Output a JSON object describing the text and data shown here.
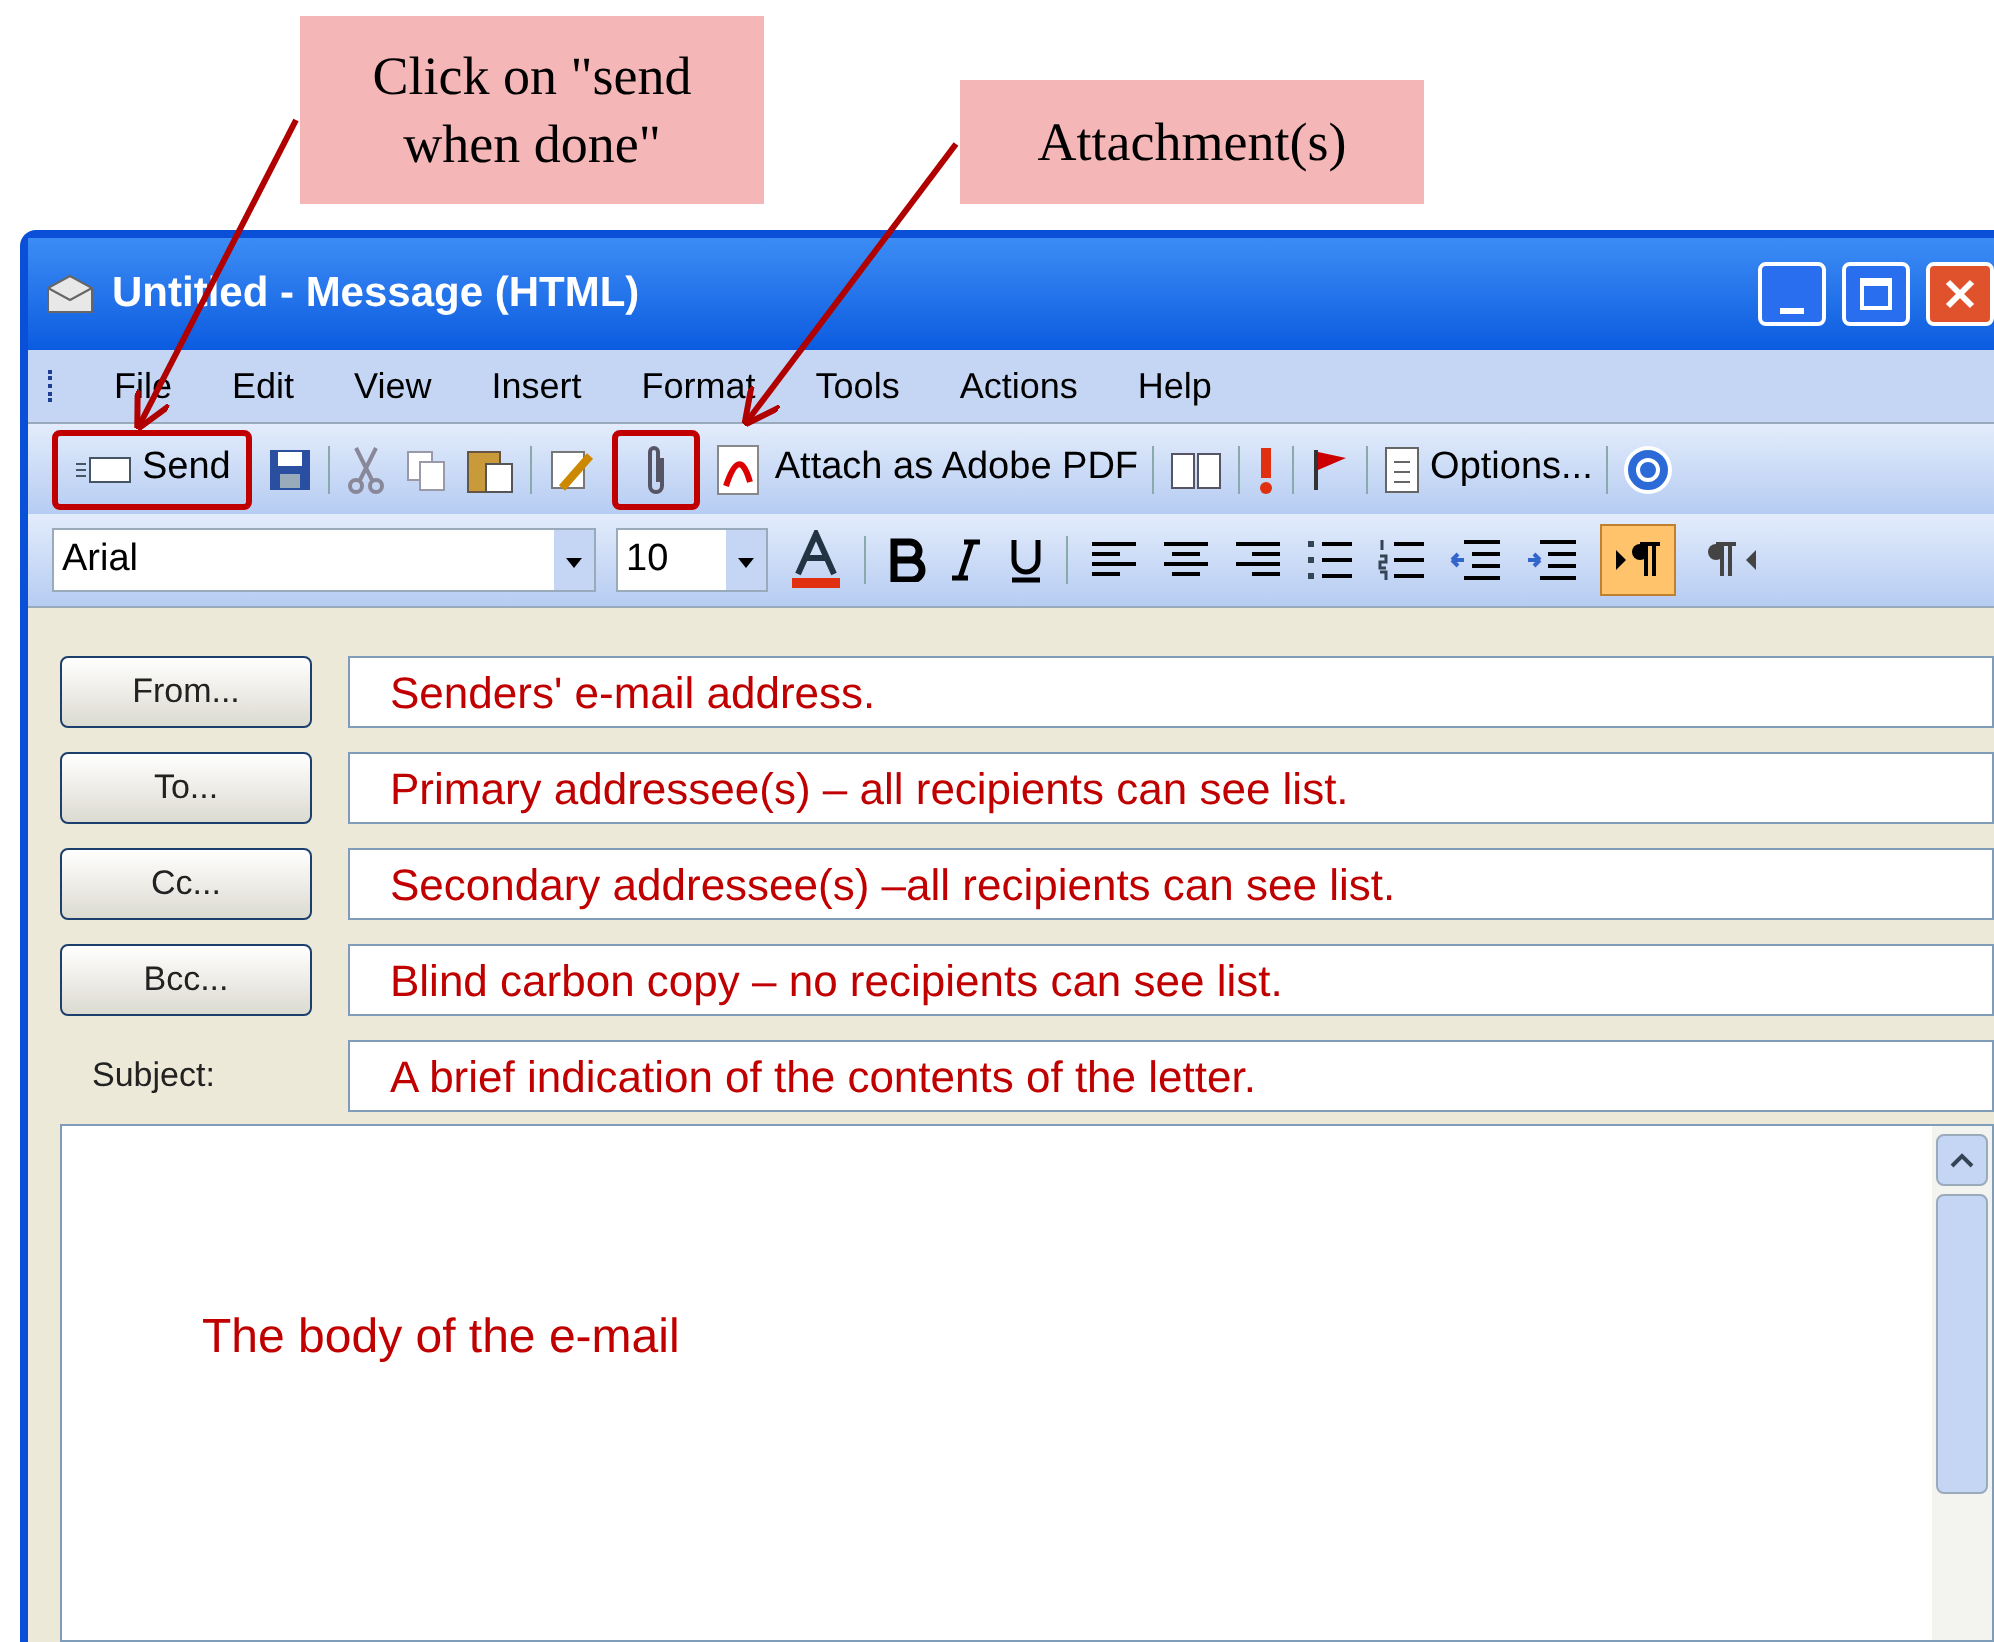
{
  "callouts": [
    {
      "text": "Click on \"send when done\""
    },
    {
      "text": "Attachment(s)"
    }
  ],
  "window": {
    "title": "Untitled - Message (HTML)"
  },
  "menu": [
    "File",
    "Edit",
    "View",
    "Insert",
    "Format",
    "Tools",
    "Actions",
    "Help"
  ],
  "standard_toolbar": {
    "send": "Send",
    "attach_pdf": "Attach as Adobe PDF",
    "options": "Options..."
  },
  "formatting_toolbar": {
    "font": "Arial",
    "size": "10",
    "ltr_selected": true,
    "rtl_selected": false
  },
  "address_rows": [
    {
      "kind": "button",
      "label": "From...",
      "value": "Senders' e-mail address."
    },
    {
      "kind": "button",
      "label": "To...",
      "value": "Primary addressee(s) – all recipients can see list."
    },
    {
      "kind": "button",
      "label": "Cc...",
      "value": "Secondary addressee(s) –all recipients can see list."
    },
    {
      "kind": "button",
      "label": "Bcc...",
      "value": "Blind carbon copy – no recipients can see list."
    },
    {
      "kind": "label",
      "label": "Subject:",
      "value": "A brief indication of the contents of the letter."
    }
  ],
  "body": "The body of the e-mail"
}
